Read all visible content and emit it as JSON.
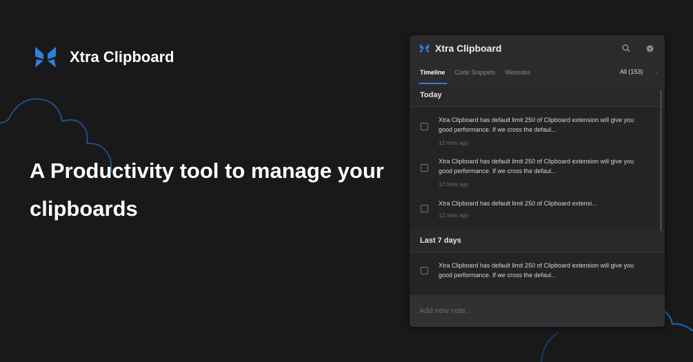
{
  "brand": {
    "name": "Xtra Clipboard",
    "accent": "#2f7fd8"
  },
  "headline": "A Productivity tool to manage your clipboards",
  "panel": {
    "title": "Xtra Clipboard",
    "tabs": [
      {
        "label": "Timeline"
      },
      {
        "label": "Code Snippets"
      },
      {
        "label": "Websites"
      }
    ],
    "filter": "All (153)",
    "sections": [
      {
        "label": "Today",
        "items": [
          {
            "text": "Xtra Clipboard has default limit 250 of Clipboard extension will give you good performance. If we cross the defaul...",
            "time": "12 mins ago"
          },
          {
            "text": "Xtra Clipboard has default limit 250 of Clipboard extension will give you good performance. If we cross the defaul...",
            "time": "12 mins ago"
          },
          {
            "text": "Xtra Clipboard has default limit 250 of Clipboard extensi...",
            "time": "12 mins ago"
          }
        ]
      },
      {
        "label": "Last 7 days",
        "items": [
          {
            "text": "Xtra Clipboard has default limit 250 of Clipboard extension will give you good performance. If we cross the defaul..."
          }
        ]
      }
    ],
    "note_placeholder": "Add new note.."
  }
}
